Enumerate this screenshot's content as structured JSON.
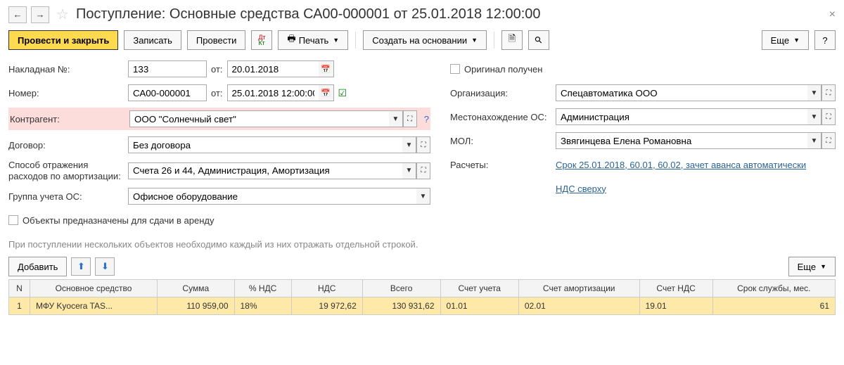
{
  "title": "Поступление: Основные средства СА00-000001 от 25.01.2018 12:00:00",
  "toolbar": {
    "post_close": "Провести и закрыть",
    "save": "Записать",
    "post": "Провести",
    "print": "Печать",
    "based_on": "Создать на основании",
    "more": "Еще",
    "help": "?"
  },
  "labels": {
    "invoice_no": "Накладная №:",
    "from": "от:",
    "number": "Номер:",
    "counterparty": "Контрагент:",
    "contract": "Договор:",
    "expense_method": "Способ отражения расходов по амортизации:",
    "os_group": "Группа учета ОС:",
    "rent_objects": "Объекты предназначены для сдачи в аренду",
    "original_received": "Оригинал получен",
    "organization": "Организация:",
    "os_location": "Местонахождение ОС:",
    "mol": "МОЛ:",
    "settlements": "Расчеты:"
  },
  "fields": {
    "invoice_no": "133",
    "invoice_date": "20.01.2018",
    "number": "СА00-000001",
    "number_date": "25.01.2018 12:00:00",
    "counterparty": "ООО \"Солнечный свет\"",
    "contract": "Без договора",
    "expense_method": "Счета 26 и 44, Администрация, Амортизация",
    "os_group": "Офисное оборудование",
    "organization": "Спецавтоматика ООО",
    "os_location": "Администрация",
    "mol": "Звягинцева Елена Романовна",
    "settlements_link": "Срок 25.01.2018, 60.01, 60.02, зачет аванса автоматически",
    "vat_link": "НДС сверху"
  },
  "hint": "При поступлении нескольких объектов необходимо каждый из них отражать отдельной строкой.",
  "add_btn": "Добавить",
  "more2": "Еще",
  "table": {
    "headers": {
      "n": "N",
      "item": "Основное средство",
      "sum": "Сумма",
      "vat_pct": "% НДС",
      "vat": "НДС",
      "total": "Всего",
      "acct": "Счет учета",
      "amort": "Счет амортизации",
      "vat_acct": "Счет НДС",
      "life": "Срок службы, мес."
    },
    "rows": [
      {
        "n": "1",
        "item": "МФУ Kyocera TAS...",
        "sum": "110 959,00",
        "vat_pct": "18%",
        "vat": "19 972,62",
        "total": "130 931,62",
        "acct": "01.01",
        "amort": "02.01",
        "vat_acct": "19.01",
        "life": "61"
      }
    ]
  }
}
